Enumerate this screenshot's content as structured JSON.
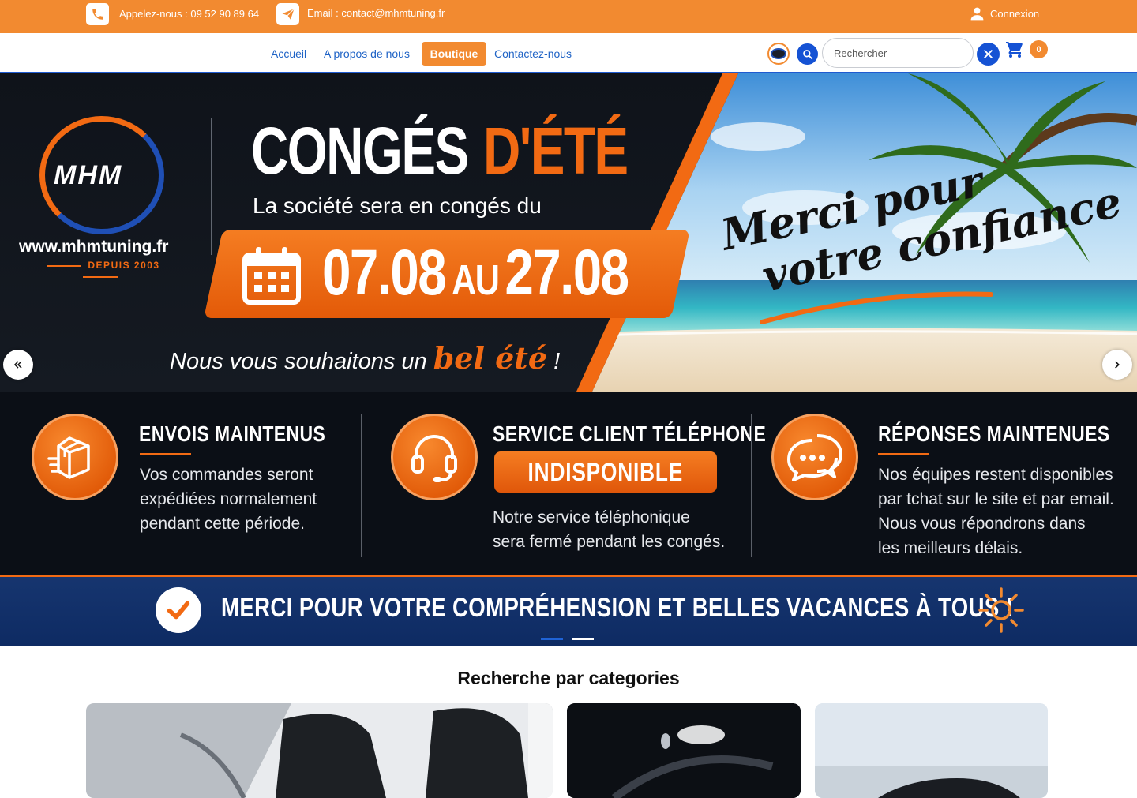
{
  "topbar": {
    "phone_label": "Appelez-nous : ",
    "phone_number": "09 52 90 89 64",
    "email": "Email : contact@mhmtuning.fr",
    "login": "Connexion",
    "icons": [
      "phone-icon",
      "send-icon",
      "user-icon"
    ]
  },
  "nav": {
    "items": [
      "Accueil",
      "A propos de nous",
      "Boutique",
      "Contactez-nous"
    ],
    "active": "Boutique",
    "search_placeholder": "Rechercher",
    "cart_count": "0"
  },
  "hero": {
    "brand": "MHM",
    "brand_url": "www.mhmtuning.fr",
    "brand_since": "DEPUIS 2003",
    "title_white": "CONGÉS",
    "title_orange": "D'ÉTÉ",
    "subtitle": "La société sera en congés du",
    "date_from": "07.08",
    "date_sep": "AU",
    "date_to": "27.08",
    "wish_start": "Nous vous souhaitons un ",
    "wish_highlight": "bel été",
    "wish_end": " !",
    "merci_line1": "Merci pour",
    "merci_line2": "votre confiance !",
    "features": [
      {
        "title": "ENVOIS MAINTENUS",
        "body": [
          "Vos commandes seront",
          "expédiées normalement",
          "pendant cette période."
        ],
        "icon": "package-icon"
      },
      {
        "title": "SERVICE CLIENT TÉLÉPHONE",
        "badge": "INDISPONIBLE",
        "body": [
          "Notre service téléphonique",
          "sera fermé pendant les congés."
        ],
        "icon": "headset-icon"
      },
      {
        "title": "RÉPONSES MAINTENUES",
        "body": [
          "Nos équipes restent disponibles",
          "par tchat sur le site et par email.",
          "Nous vous répondrons dans",
          "les meilleurs délais."
        ],
        "icon": "chat-icon"
      }
    ],
    "band_text": "MERCI POUR VOTRE COMPRÉHENSION ET BELLES VACANCES À TOUS !"
  },
  "categories": {
    "title": "Recherche par categories"
  },
  "colors": {
    "orange": "#f28a30",
    "orange_dark": "#e15a08",
    "blue": "#1552d4",
    "navy": "#0e2b63",
    "link": "#1f63c6"
  }
}
